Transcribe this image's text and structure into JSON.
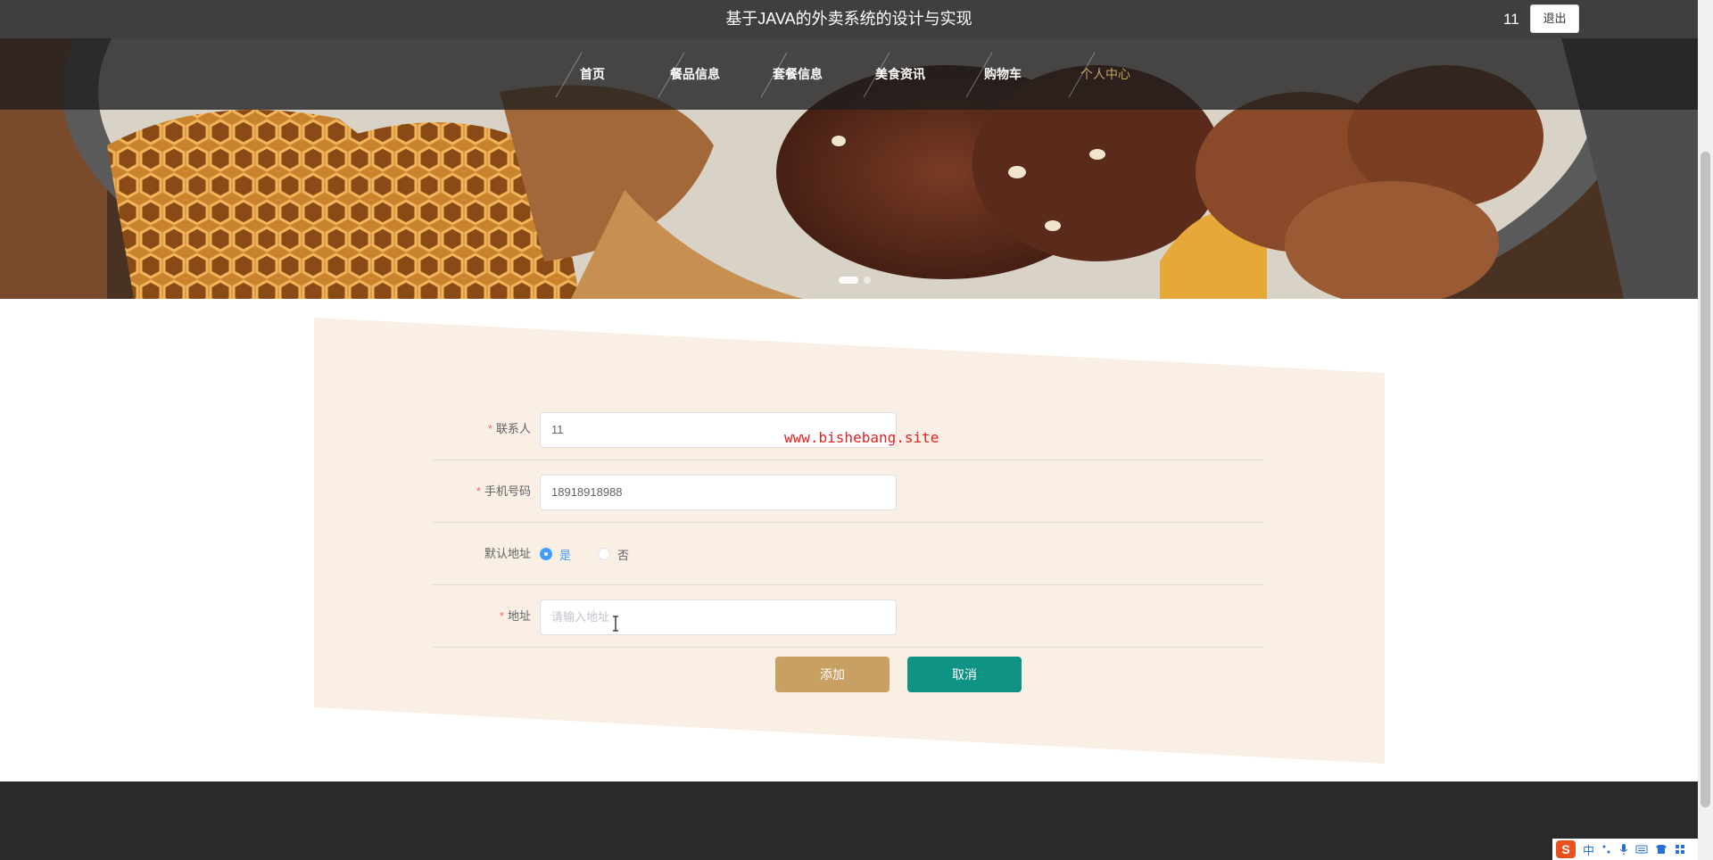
{
  "header": {
    "site_title": "基于JAVA的外卖系统的设计与实现",
    "user_name": "11",
    "logout_label": "退出"
  },
  "nav": {
    "items": [
      "首页",
      "餐品信息",
      "套餐信息",
      "美食资讯",
      "购物车",
      "个人中心"
    ],
    "active_index": 5
  },
  "form": {
    "contact": {
      "label": "联系人",
      "value": "11",
      "required": true
    },
    "phone": {
      "label": "手机号码",
      "value": "18918918988",
      "required": true
    },
    "default_address": {
      "label": "默认地址",
      "options": [
        "是",
        "否"
      ],
      "selected": "是"
    },
    "address": {
      "label": "地址",
      "value": "",
      "placeholder": "请输入地址",
      "required": true
    },
    "add_label": "添加",
    "cancel_label": "取消"
  },
  "watermark": "www.bishebang.site",
  "ime": {
    "lang": "中",
    "logo": "S"
  },
  "colors": {
    "accent_gold": "#c8a063",
    "accent_teal": "#0f9385",
    "form_bg": "#f9efe4",
    "topbar": "#3f3f3f",
    "footer": "#2a2a2a",
    "watermark": "#e02020",
    "radio_checked": "#409eff"
  }
}
